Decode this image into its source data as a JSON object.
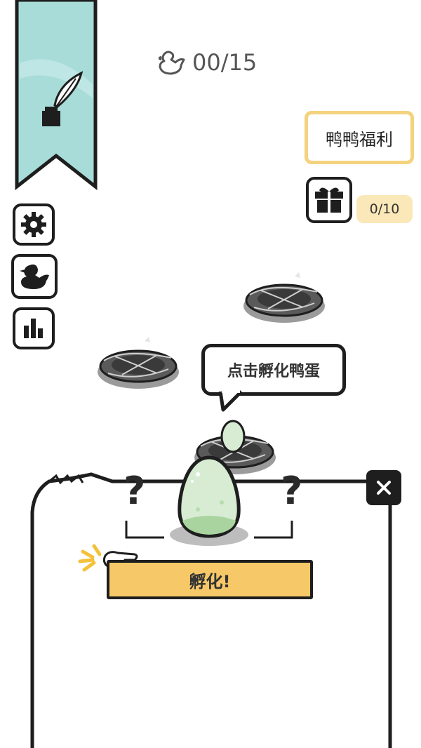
{
  "counter": {
    "icon": "duck-outline-icon",
    "value": "00/15"
  },
  "welfare": {
    "label": "鸭鸭福利"
  },
  "gift": {
    "icon": "gift-icon",
    "progress": "0/10"
  },
  "sidebar": {
    "banner_icon": "quill-inkpot-icon",
    "banner_color": "#a8dcd9",
    "buttons": [
      {
        "icon": "gear-icon"
      },
      {
        "icon": "duck-icon"
      },
      {
        "icon": "bar-chart-icon"
      }
    ]
  },
  "hint": {
    "text": "点击孵化鸭蛋"
  },
  "panel": {
    "unknown_left": "?",
    "unknown_right": "?",
    "egg_color": "#d7ecd3",
    "hatch_label": "孵化!",
    "close_icon": "close-icon"
  },
  "colors": {
    "accent_yellow": "#f7c867",
    "welfare_border": "#f4d27e",
    "ink": "#1e1e1e"
  }
}
